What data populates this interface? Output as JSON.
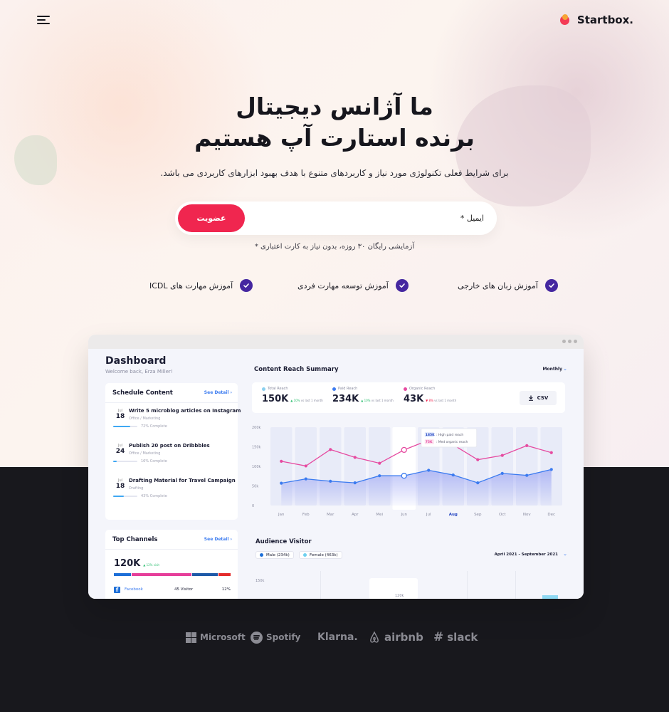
{
  "brand": {
    "name": "Startbox.",
    "menu_icon": "hamburger-icon"
  },
  "hero": {
    "title_line1": "ما آژانس دیجیتال",
    "title_line2": "برنده استارت آپ هستیم",
    "subtitle": "برای شرایط فعلی تکنولوژی مورد نیاز و کاربردهای متنوع با هدف بهبود ابزارهای کاربردی می باشد.",
    "email_placeholder": "ایمیل *",
    "join_label": "عضویت",
    "trial_note": "آزمایشی رایگان ۳۰ روزه، بدون نیاز به کارت اعتباری *"
  },
  "features": [
    {
      "label": "آموزش زبان های خارجی",
      "icon": "check-circle-icon"
    },
    {
      "label": "آموزش توسعه مهارت فردی",
      "icon": "check-circle-icon"
    },
    {
      "label": "آموزش مهارت های ICDL",
      "icon": "check-circle-icon"
    }
  ],
  "dashboard": {
    "title": "Dashboard",
    "welcome": "Welcome back, Erza Miller!",
    "schedule": {
      "title": "Schedule Content",
      "see_detail": "See Detail",
      "tasks": [
        {
          "month": "Jul",
          "day": "18",
          "title": "Write 5 microblog articles on Instagram",
          "tags": "Office / Marketing",
          "progress": 72,
          "progress_label": "72% Complete"
        },
        {
          "month": "Jul",
          "day": "24",
          "title": "Publish 20 post on Dribbbles",
          "tags": "Office / Marketing",
          "progress": 16,
          "progress_label": "16% Complete"
        },
        {
          "month": "Jul",
          "day": "18",
          "title": "Drafting Material for Travel Campaign",
          "tags": "Drafting",
          "progress": 43,
          "progress_label": "43% Complete"
        }
      ]
    },
    "channels": {
      "title": "Top Channels",
      "see_detail": "See Detail",
      "total": "120K",
      "delta": "▲ 12% visit",
      "row": {
        "name": "Facebook",
        "visitors": "45 Visitor",
        "percent": "12%"
      }
    },
    "reach": {
      "title": "Content Reach Summary",
      "period": "Monthly",
      "csv_label": "CSV",
      "stats": [
        {
          "label": "Total Reach",
          "value": "150K",
          "delta": "▲ 10%",
          "note": "vs last 1 month",
          "color": "#8ad0ef"
        },
        {
          "label": "Paid Reach",
          "value": "234K",
          "delta": "▲ 10%",
          "note": "vs last 1 month",
          "color": "#3b7bf0"
        },
        {
          "label": "Organic Reach",
          "value": "43K",
          "delta": "▼ 8%",
          "note": "vs last 1 month",
          "color": "#e64aa0"
        }
      ],
      "tooltip": [
        {
          "value": "185K",
          "label": "High paid reach"
        },
        {
          "value": "75K",
          "label": "Med organic reach"
        }
      ]
    },
    "audience": {
      "title": "Audience Visitor",
      "male": "Male (234k)",
      "female": "Female (463k)",
      "range": "April 2021 - September 2021",
      "y_top": "150k",
      "tip": "120k"
    }
  },
  "chart_data": {
    "type": "line",
    "title": "Content Reach Summary",
    "categories": [
      "Jan",
      "Feb",
      "Mar",
      "Apr",
      "Mei",
      "Jun",
      "Jul",
      "Aug",
      "Sep",
      "Oct",
      "Nov",
      "Dec"
    ],
    "y_ticks": [
      "0",
      "50k",
      "100k",
      "150k",
      "200k"
    ],
    "ylim": [
      0,
      200
    ],
    "series": [
      {
        "name": "Paid Reach",
        "color": "#e64aa0",
        "values": [
          113,
          101,
          143,
          123,
          108,
          142,
          167,
          155,
          117,
          128,
          153,
          135
        ]
      },
      {
        "name": "Organic Reach",
        "color": "#3b7bf0",
        "values": [
          57,
          68,
          62,
          58,
          76,
          76,
          90,
          78,
          58,
          82,
          77,
          92
        ]
      }
    ],
    "highlight": "Aug"
  },
  "partners": [
    "Microsoft",
    "Spotify",
    "Klarna.",
    "airbnb",
    "slack"
  ]
}
